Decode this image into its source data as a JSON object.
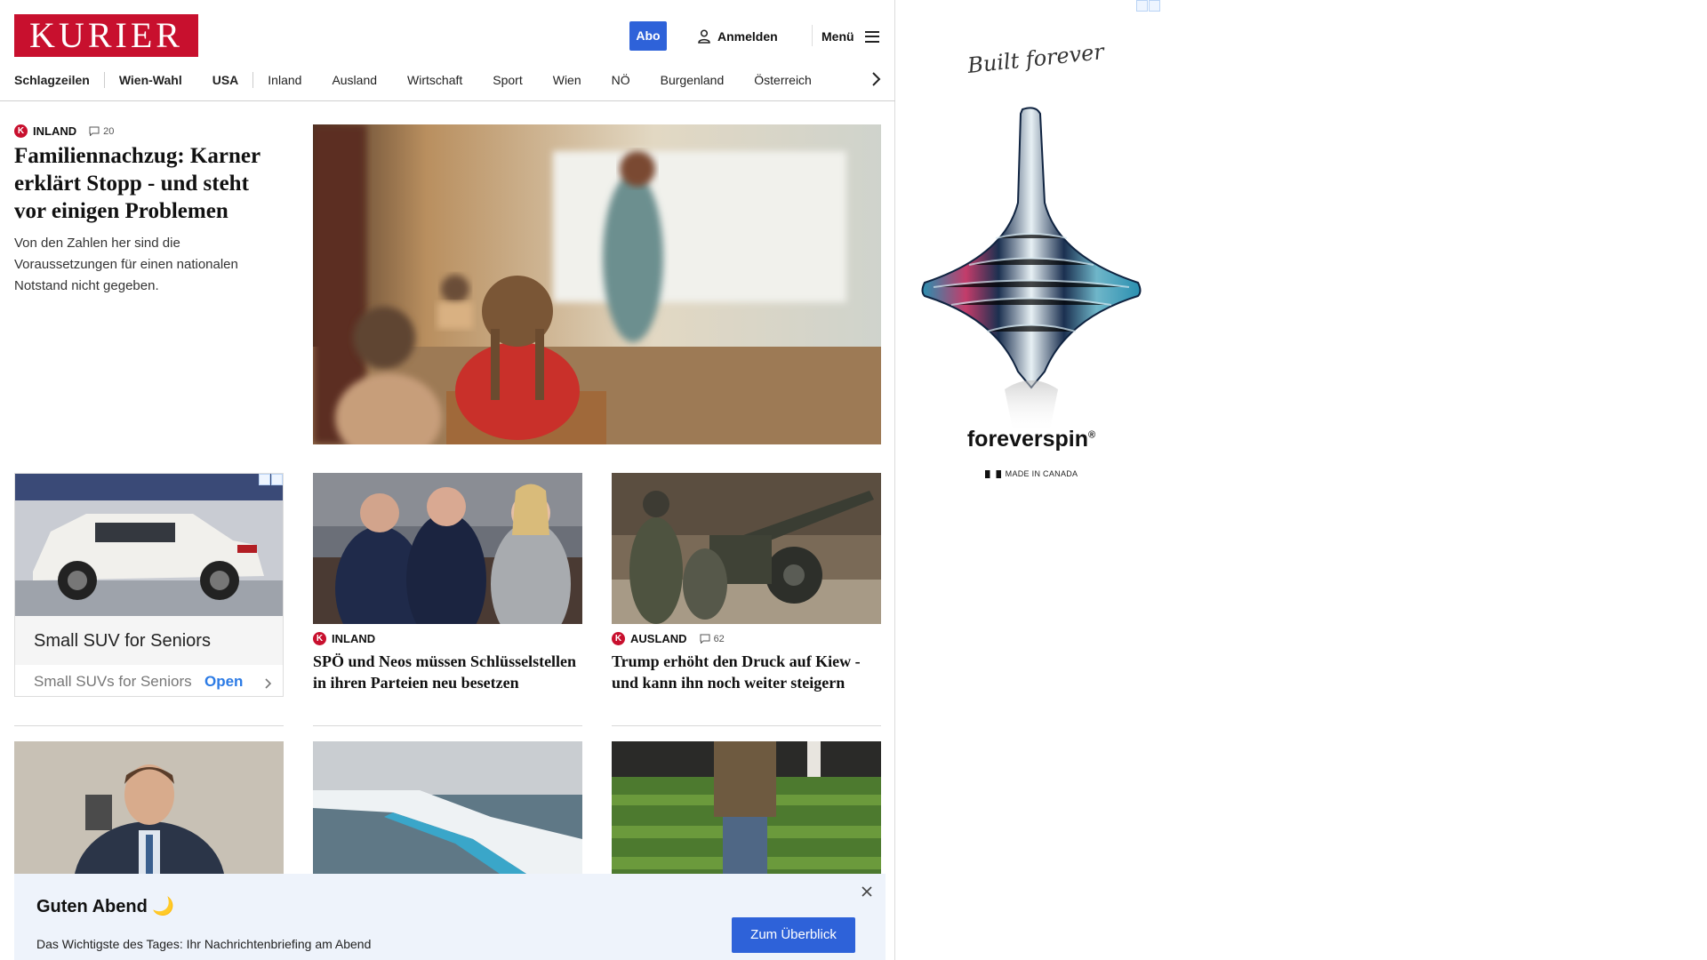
{
  "header": {
    "logo": "KURIER",
    "abo_label": "Abo",
    "login_label": "Anmelden",
    "menu_label": "Menü"
  },
  "nav": {
    "items": [
      "Schlagzeilen",
      "Wien-Wahl",
      "USA",
      "Inland",
      "Ausland",
      "Wirtschaft",
      "Sport",
      "Wien",
      "NÖ",
      "Burgenland",
      "Österreich"
    ]
  },
  "lead": {
    "category": "INLAND",
    "comments": "20",
    "title": "Familiennachzug: Karner erklärt Stopp - und steht vor einigen Problemen",
    "teaser": "Von den Zahlen her sind die Voraussetzungen für einen nationalen Notstand nicht gegeben."
  },
  "native_ad": {
    "title": "Small SUV for Seniors",
    "subtitle": "Small SUVs for Seniors",
    "cta": "Open"
  },
  "cards": [
    {
      "category": "INLAND",
      "title": "SPÖ und Neos müssen Schlüsselstellen in ihren Parteien neu besetzen"
    },
    {
      "category": "AUSLAND",
      "comments": "62",
      "title": "Trump erhöht den Druck auf Kiew - und kann ihn noch weiter steigern"
    }
  ],
  "banner_ad": {
    "signature": "Built forever",
    "brand": "foreverspin",
    "made_in": "MADE IN CANADA"
  },
  "notice": {
    "title": "Guten Abend 🌙",
    "text": "Das Wichtigste des Tages: Ihr Nachrichtenbriefing am Abend",
    "button": "Zum Überblick"
  },
  "colors": {
    "brand_red": "#c8102e",
    "accent_blue": "#2e62d9",
    "notice_bg": "#eef3fb"
  }
}
